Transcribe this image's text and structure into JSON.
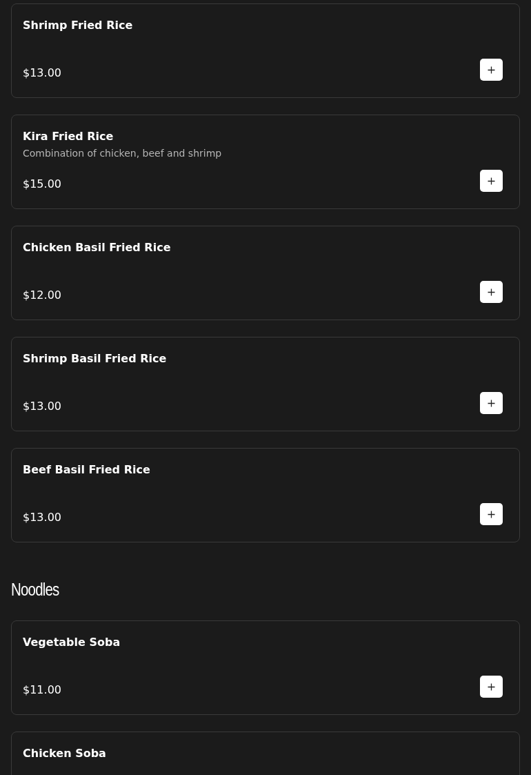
{
  "sections": [
    {
      "items": [
        {
          "name": "Shrimp Fried Rice",
          "price": "$13.00"
        },
        {
          "name": "Kira Fried Rice",
          "description": "Combination of chicken, beef and shrimp",
          "price": "$15.00"
        },
        {
          "name": "Chicken Basil Fried Rice",
          "price": "$12.00"
        },
        {
          "name": "Shrimp Basil Fried Rice",
          "price": "$13.00"
        },
        {
          "name": "Beef Basil Fried Rice",
          "price": "$13.00"
        }
      ]
    },
    {
      "title": "Noodles",
      "items": [
        {
          "name": "Vegetable Soba",
          "price": "$11.00"
        },
        {
          "name": "Chicken Soba"
        }
      ]
    }
  ]
}
